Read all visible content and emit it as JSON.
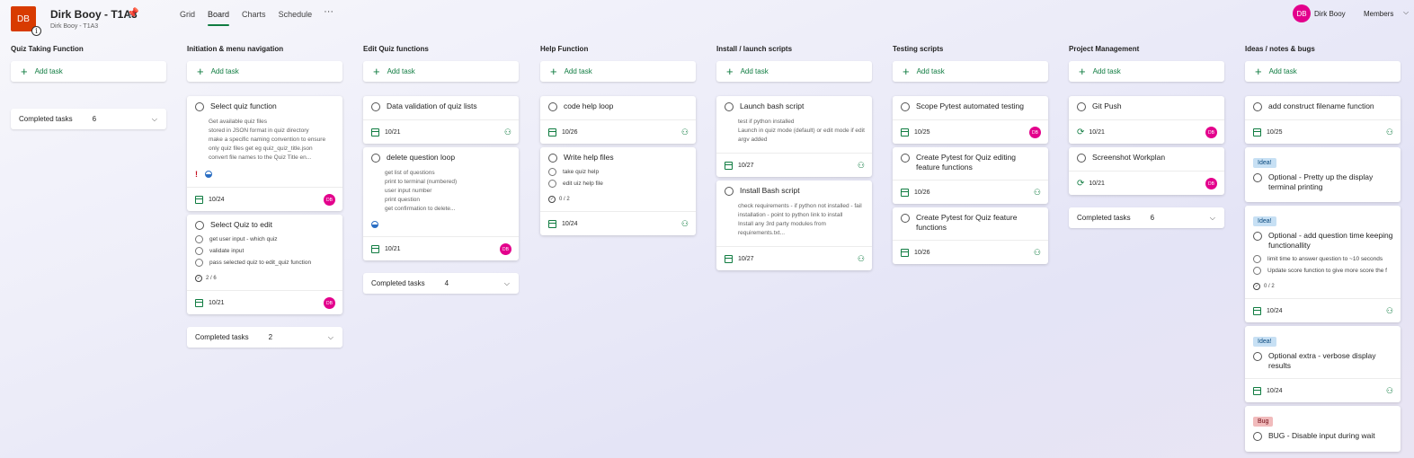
{
  "header": {
    "avatar_initials": "DB",
    "info_glyph": "i",
    "plan_title": "Dirk Booy - T1A3",
    "plan_subtitle": "Dirk Booy - T1A3",
    "views": [
      "Grid",
      "Board",
      "Charts",
      "Schedule"
    ],
    "active_view": "Board",
    "more_glyph": "···",
    "user_initials": "DB",
    "user_name": "Dirk Booy",
    "members_label": "Members"
  },
  "colors": {
    "accent": "#107c41",
    "avatar": "#e3008c",
    "plan_tile": "#d83b01"
  },
  "add_task_label": "Add task",
  "buckets": [
    {
      "name": "Quiz Taking Function",
      "cards": [],
      "completed": {
        "label": "Completed tasks",
        "count": "6"
      }
    },
    {
      "name": "Initiation & menu navigation",
      "cards": [
        {
          "title": "Select quiz function",
          "description": "Get available quiz files\nstored in JSON format in quiz directory\nmake a specific naming convention to ensure only quiz files get eg quiz_quiz_title.json\nconvert file names to the Quiz Title en...",
          "priority": "urgent",
          "progress": "in-progress",
          "date": "10/24",
          "assignee": "DB"
        },
        {
          "title": "Select Quiz to edit",
          "checklist": [
            "get user input - which quiz",
            "validate input",
            "pass selected quiz to edit_quiz function"
          ],
          "checklist_count": "2 / 6",
          "date": "10/21",
          "assignee": "DB"
        }
      ],
      "completed": {
        "label": "Completed tasks",
        "count": "2"
      }
    },
    {
      "name": "Edit Quiz functions",
      "cards": [
        {
          "title": "Data validation of quiz lists",
          "date": "10/21",
          "assignee_icon": "assign-icon"
        },
        {
          "title": "delete question loop",
          "description": "get list of questions\nprint to terminal (numbered)\nuser input number\nprint question\nget confirmation to delete...",
          "progress": "in-progress",
          "date": "10/21",
          "assignee": "DB"
        }
      ],
      "completed": {
        "label": "Completed tasks",
        "count": "4"
      }
    },
    {
      "name": "Help Function",
      "cards": [
        {
          "title": "code help loop",
          "date": "10/26",
          "assignee_icon": "assign-icon"
        },
        {
          "title": "Write help files",
          "checklist": [
            "take quiz help",
            "edit uiz help file"
          ],
          "checklist_count": "0 / 2",
          "date": "10/24",
          "assignee_icon": "assign-icon"
        }
      ]
    },
    {
      "name": "Install / launch scripts",
      "cards": [
        {
          "title": "Launch bash script",
          "description": "test if python installed\nLaunch in quiz mode (default) or edit mode if edit argv added",
          "date": "10/27",
          "assignee_icon": "assign-icon"
        },
        {
          "title": "Install Bash script",
          "description": "check requirements - if python not installed - fail installation - point to python link to install\nInstall any 3rd party modules from requirements.txt...",
          "date": "10/27",
          "assignee_icon": "assign-icon"
        }
      ]
    },
    {
      "name": "Testing scripts",
      "cards": [
        {
          "title": "Scope Pytest automated testing",
          "date": "10/25",
          "assignee": "DB"
        },
        {
          "title": "Create Pytest for Quiz editing feature functions",
          "date": "10/26",
          "assignee_icon": "assign-icon"
        },
        {
          "title": "Create Pytest for Quiz feature functions",
          "date": "10/26",
          "assignee_icon": "assign-icon"
        }
      ]
    },
    {
      "name": "Project Management",
      "cards": [
        {
          "title": "Git Push",
          "date": "10/21",
          "repeat": true,
          "assignee": "DB"
        },
        {
          "title": "Screenshot Workplan",
          "date": "10/21",
          "repeat": true,
          "assignee": "DB"
        }
      ],
      "completed": {
        "label": "Completed tasks",
        "count": "6"
      }
    },
    {
      "name": "Ideas / notes & bugs",
      "cards": [
        {
          "title": "add construct filename function",
          "date": "10/25",
          "assignee_icon": "assign-icon"
        },
        {
          "label": "Idea!",
          "label_type": "idea",
          "title": "Optional - Pretty up the display terminal printing"
        },
        {
          "label": "Idea!",
          "label_type": "idea",
          "title": "Optional - add question time keeping functionallity",
          "checklist": [
            "limit time to answer question to ~10 seconds",
            "Update score function to give more score the f"
          ],
          "checklist_count": "0 / 2",
          "date": "10/24",
          "assignee_icon": "assign-icon"
        },
        {
          "label": "Idea!",
          "label_type": "idea",
          "title": "Optional extra - verbose display results",
          "date": "10/24",
          "assignee_icon": "assign-icon"
        },
        {
          "label": "Bug",
          "label_type": "bug",
          "title": "BUG - Disable input during wait"
        }
      ]
    }
  ]
}
